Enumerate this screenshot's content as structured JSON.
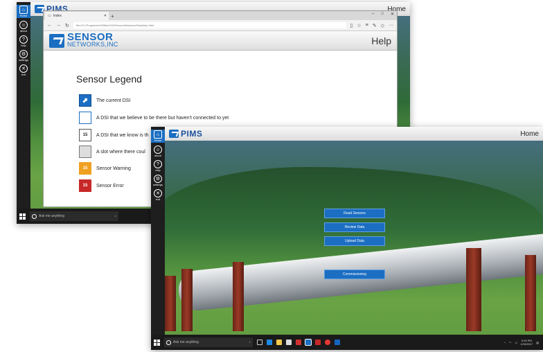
{
  "back_window": {
    "app_logo": "PIMS",
    "home_link": "Home",
    "sidebar": [
      {
        "label": "Home",
        "icon": "home-icon"
      },
      {
        "label": "about",
        "icon": "about-icon"
      },
      {
        "label": "help",
        "icon": "help-icon"
      },
      {
        "label": "settings",
        "icon": "settings-icon"
      },
      {
        "label": "exit",
        "icon": "exit-icon"
      }
    ],
    "taskbar": {
      "search_placeholder": "Ask me anything"
    }
  },
  "browser": {
    "tab_title": "Index",
    "new_tab": "+",
    "window_controls": [
      "–",
      "□",
      "✕"
    ],
    "address": "file:///C:/Programs%20files/%20SensorNetworks/Help/help.html",
    "page_header": {
      "logo_line1": "SENSOR",
      "logo_line2": "NETWORKS,INC",
      "title": "Help"
    },
    "legend_title": "Sensor Legend",
    "legend": [
      {
        "text": "The current DSI",
        "badge": "",
        "style": "current"
      },
      {
        "text": "A DSI that we believe to be there but haven't connected to yet",
        "badge": "",
        "style": "unconnected"
      },
      {
        "text": "A DSI that we know is th",
        "badge": "15",
        "style": "known"
      },
      {
        "text": "A slot where there coul",
        "badge": "",
        "style": "slot"
      },
      {
        "text": "Sensor Warning",
        "badge": "15",
        "style": "warning"
      },
      {
        "text": "Sensor Error",
        "badge": "15",
        "style": "error"
      }
    ]
  },
  "front_window": {
    "app_logo": "PIMS",
    "home_link": "Home",
    "sidebar": [
      {
        "label": "Home",
        "icon": "home-icon"
      },
      {
        "label": "about",
        "icon": "about-icon"
      },
      {
        "label": "help",
        "icon": "help-icon"
      },
      {
        "label": "settings",
        "icon": "settings-icon"
      },
      {
        "label": "exit",
        "icon": "exit-icon"
      }
    ],
    "buttons": [
      "Read Sensors",
      "Review Data",
      "Upload Data",
      "Commissioning"
    ],
    "taskbar": {
      "search_placeholder": "Ask me anything",
      "time": "5:25 PM",
      "date": "12/9/2017"
    }
  },
  "colors": {
    "brand_blue": "#1b6ec2",
    "warning": "#f0a020",
    "error": "#c82828"
  }
}
